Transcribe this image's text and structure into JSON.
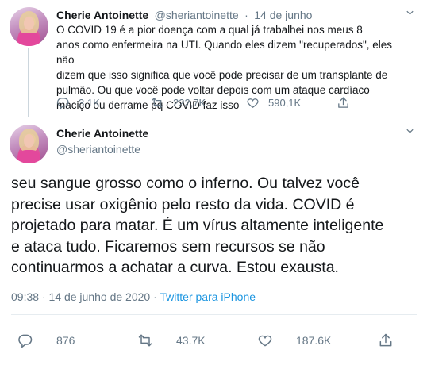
{
  "tweet1": {
    "name": "Cherie Antoinette",
    "handle": "@sheriantoinette",
    "separator": "·",
    "date": "14 de junho",
    "text": "O COVID 19 é a pior doença com a qual já trabalhei nos meus 8\nanos como enfermeira na UTI. Quando eles dizem \"recuperados\", eles não\ndizem que isso significa que você pode precisar de um transplante de\npulmão. Ou que você pode voltar depois com um ataque cardíaco\nmaciço ou derrame pq COVID faz isso",
    "replies": "3.1K",
    "retweets": "222,7K",
    "likes": "590,1K"
  },
  "tweet2": {
    "name": "Cherie Antoinette",
    "handle": "@sheriantoinette",
    "text": "seu sangue grosso como o inferno. Ou talvez você\nprecise usar oxigênio pelo resto da vida. COVID é\nprojetado para matar. É um vírus altamente inteligente\ne ataca tudo. Ficaremos sem recursos se não\ncontinuarmos a achatar a curva. Estou exausta.",
    "time": "09:38",
    "separator": "·",
    "date": "14 de junho de 2020",
    "source": "Twitter para iPhone",
    "replies": "876",
    "retweets": "43.7K",
    "likes": "187.6K"
  },
  "icons": {
    "reply": "reply-icon",
    "retweet": "retweet-icon",
    "like": "heart-icon",
    "share": "share-icon",
    "more": "chevron-down-icon"
  },
  "colors": {
    "link": "#1b95e0",
    "secondary_text": "#657786",
    "primary_text": "#14171a",
    "border": "#e6ecf0"
  }
}
